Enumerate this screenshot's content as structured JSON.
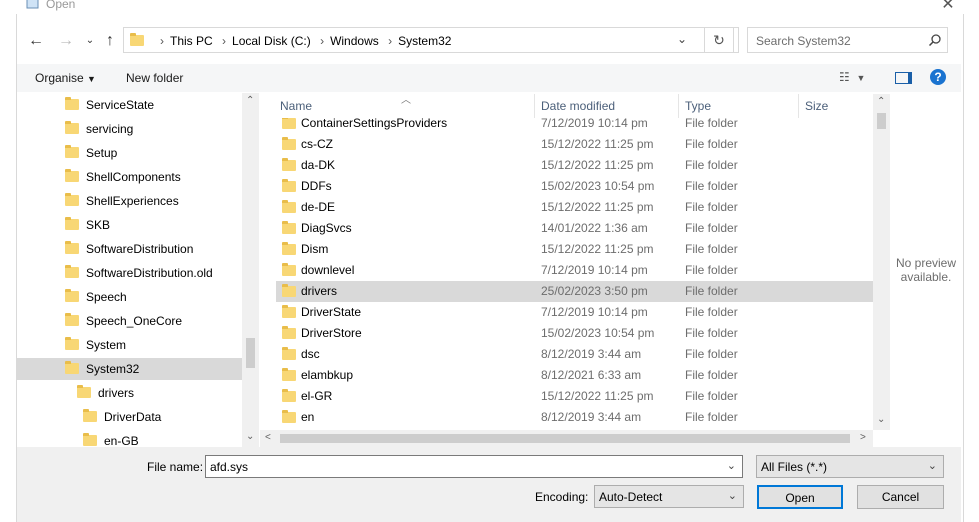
{
  "window": {
    "title": "Open"
  },
  "nav": {
    "breadcrumbs": [
      "This PC",
      "Local Disk (C:)",
      "Windows",
      "System32"
    ],
    "search_placeholder": "Search System32"
  },
  "toolbar": {
    "organise_label": "Organise",
    "new_folder_label": "New folder"
  },
  "tree": [
    {
      "label": "ServiceState",
      "indent": 0
    },
    {
      "label": "servicing",
      "indent": 0
    },
    {
      "label": "Setup",
      "indent": 0
    },
    {
      "label": "ShellComponents",
      "indent": 0
    },
    {
      "label": "ShellExperiences",
      "indent": 0
    },
    {
      "label": "SKB",
      "indent": 0
    },
    {
      "label": "SoftwareDistribution",
      "indent": 0
    },
    {
      "label": "SoftwareDistribution.old",
      "indent": 0
    },
    {
      "label": "Speech",
      "indent": 0
    },
    {
      "label": "Speech_OneCore",
      "indent": 0
    },
    {
      "label": "System",
      "indent": 0
    },
    {
      "label": "System32",
      "indent": 0,
      "selected": true
    },
    {
      "label": "drivers",
      "indent": 1
    },
    {
      "label": "DriverData",
      "indent": 2
    },
    {
      "label": "en-GB",
      "indent": 2
    }
  ],
  "columns": {
    "name": "Name",
    "date": "Date modified",
    "type": "Type",
    "size": "Size"
  },
  "files": [
    {
      "name": "ContainerSettingsProviders",
      "date": "7/12/2019 10:14 pm",
      "type": "File folder"
    },
    {
      "name": "cs-CZ",
      "date": "15/12/2022 11:25 pm",
      "type": "File folder"
    },
    {
      "name": "da-DK",
      "date": "15/12/2022 11:25 pm",
      "type": "File folder"
    },
    {
      "name": "DDFs",
      "date": "15/02/2023 10:54 pm",
      "type": "File folder"
    },
    {
      "name": "de-DE",
      "date": "15/12/2022 11:25 pm",
      "type": "File folder"
    },
    {
      "name": "DiagSvcs",
      "date": "14/01/2022 1:36 am",
      "type": "File folder"
    },
    {
      "name": "Dism",
      "date": "15/12/2022 11:25 pm",
      "type": "File folder"
    },
    {
      "name": "downlevel",
      "date": "7/12/2019 10:14 pm",
      "type": "File folder"
    },
    {
      "name": "drivers",
      "date": "25/02/2023 3:50 pm",
      "type": "File folder",
      "selected": true
    },
    {
      "name": "DriverState",
      "date": "7/12/2019 10:14 pm",
      "type": "File folder"
    },
    {
      "name": "DriverStore",
      "date": "15/02/2023 10:54 pm",
      "type": "File folder"
    },
    {
      "name": "dsc",
      "date": "8/12/2019 3:44 am",
      "type": "File folder"
    },
    {
      "name": "elambkup",
      "date": "8/12/2021 6:33 am",
      "type": "File folder"
    },
    {
      "name": "el-GR",
      "date": "15/12/2022 11:25 pm",
      "type": "File folder"
    },
    {
      "name": "en",
      "date": "8/12/2019 3:44 am",
      "type": "File folder"
    }
  ],
  "preview": {
    "text": "No preview available."
  },
  "bottom": {
    "filename_label": "File name:",
    "filename_value": "afd.sys",
    "filetype_value": "All Files  (*.*)",
    "encoding_label": "Encoding:",
    "encoding_value": "Auto-Detect",
    "open_label": "Open",
    "cancel_label": "Cancel"
  }
}
